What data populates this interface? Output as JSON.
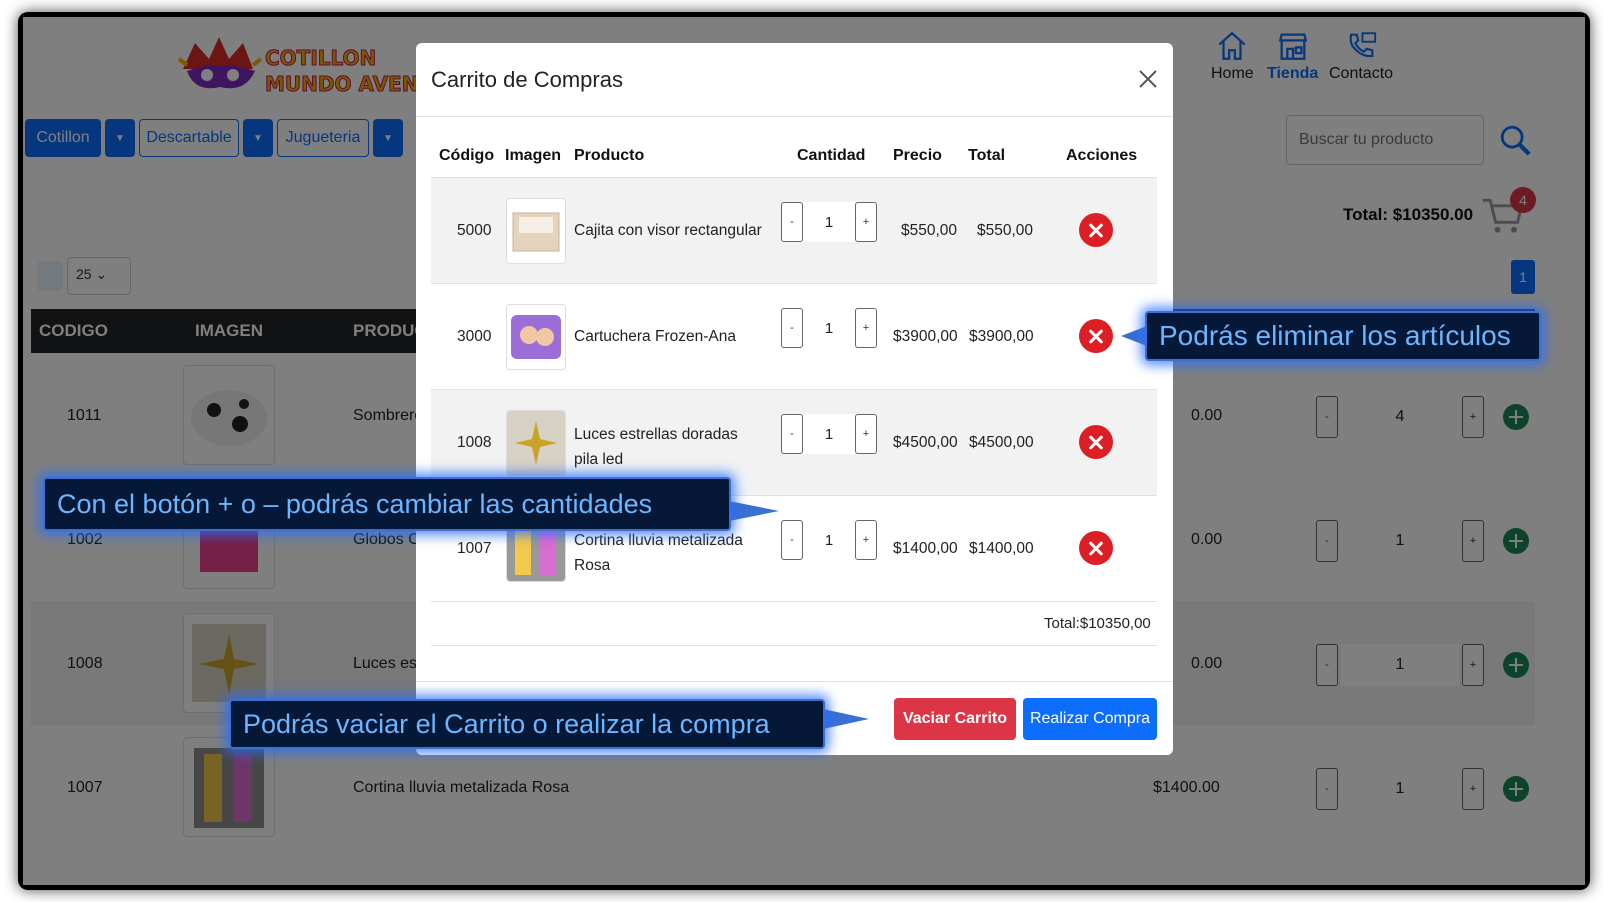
{
  "header": {
    "nav": [
      {
        "label": "Home",
        "icon": "home-icon"
      },
      {
        "label": "Tienda",
        "icon": "store-icon",
        "active": true
      },
      {
        "label": "Contacto",
        "icon": "contact-icon"
      }
    ],
    "categories": [
      "Cotillon",
      "Descartable",
      "Jugueteria"
    ],
    "search_placeholder": "Buscar tu producto",
    "cart_total": "Total: $10350.00",
    "cart_count": "4"
  },
  "listing": {
    "page_size": "25",
    "current_page": "1",
    "columns": [
      "CODIGO",
      "IMAGEN",
      "PRODUC"
    ],
    "rows": [
      {
        "codigo": "1011",
        "producto": "Sombrero",
        "precio": "0.00",
        "cantidad": "4"
      },
      {
        "codigo": "1002",
        "producto": "Globos C",
        "precio": "0.00",
        "cantidad": "1"
      },
      {
        "codigo": "1008",
        "producto": "Luces est",
        "precio": "0.00",
        "cantidad": "1"
      },
      {
        "codigo": "1007",
        "producto": "Cortina lluvia metalizada Rosa",
        "precio": "$1400.00",
        "cantidad": "1"
      }
    ]
  },
  "modal": {
    "title": "Carrito de Compras",
    "headers": {
      "codigo": "Código",
      "imagen": "Imagen",
      "producto": "Producto",
      "cantidad": "Cantidad",
      "precio": "Precio",
      "total": "Total",
      "acciones": "Acciones"
    },
    "items": [
      {
        "codigo": "5000",
        "producto": "Cajita con visor rectangular",
        "cantidad": "1",
        "precio": "$550,00",
        "total": "$550,00"
      },
      {
        "codigo": "3000",
        "producto": "Cartuchera Frozen-Ana",
        "cantidad": "1",
        "precio": "$3900,00",
        "total": "$3900,00"
      },
      {
        "codigo": "1008",
        "producto": "Luces estrellas doradas pila led",
        "cantidad": "1",
        "precio": "$4500,00",
        "total": "$4500,00"
      },
      {
        "codigo": "1007",
        "producto": "Cortina lluvia metalizada Rosa",
        "cantidad": "1",
        "precio": "$1400,00",
        "total": "$1400,00"
      }
    ],
    "total": "Total:$10350,00",
    "empty_button": "Vaciar Carrito",
    "buy_button": "Realizar Compra",
    "minus": "-",
    "plus": "+"
  },
  "callouts": {
    "delete": "Podrás eliminar los artículos",
    "quantity": "Con el botón + o – podrás cambiar las cantidades",
    "actions": "Podrás vaciar el Carrito o realizar la compra"
  },
  "colors": {
    "primary": "#0d6efd",
    "danger": "#dc3545",
    "success": "#198754",
    "callout_bg": "#061838",
    "callout_text": "#6cb6ff"
  }
}
